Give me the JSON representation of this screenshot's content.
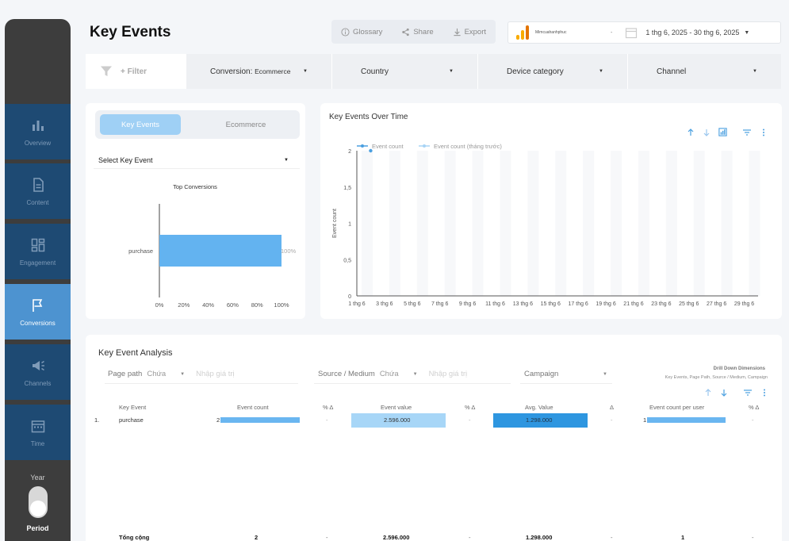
{
  "sidebar": {
    "items": [
      {
        "label": "Overview",
        "icon": "bar-chart-icon"
      },
      {
        "label": "Content",
        "icon": "document-icon"
      },
      {
        "label": "Engagement",
        "icon": "dashboard-icon"
      },
      {
        "label": "Conversions",
        "icon": "flag-icon",
        "active": true
      },
      {
        "label": "Channels",
        "icon": "megaphone-icon"
      },
      {
        "label": "Time",
        "icon": "calendar-icon"
      }
    ],
    "period": {
      "top_label": "Year",
      "label": "Period"
    }
  },
  "header": {
    "title": "Key Events",
    "buttons": {
      "glossary": "Glossary",
      "share": "Share",
      "export": "Export"
    },
    "account_name": "Mimcuahanhphuc",
    "account_caret": "-",
    "date_range": "1 thg 6, 2025 - 30 thg 6, 2025"
  },
  "filterbar": {
    "filter_label": "+ Filter",
    "conversion_label": "Conversion:",
    "conversion_value": "Ecommerce",
    "country": "Country",
    "device": "Device category",
    "channel": "Channel"
  },
  "left_panel": {
    "tabs": {
      "key_events": "Key Events",
      "ecommerce": "Ecommerce"
    },
    "select_placeholder": "Select Key Event"
  },
  "top_conversions_chart": {
    "chart_data": {
      "type": "bar",
      "orientation": "horizontal",
      "title": "Top Conversions",
      "categories": [
        "purchase"
      ],
      "values": [
        100
      ],
      "data_labels": [
        "100%"
      ],
      "xlim": [
        0,
        100
      ],
      "x_ticks": [
        "0%",
        "20%",
        "40%",
        "60%",
        "80%",
        "100%"
      ],
      "color": "#63b3f0"
    }
  },
  "over_time_chart": {
    "chart_data": {
      "type": "line",
      "title": "Key Events Over Time",
      "ylabel": "Event count",
      "ylim": [
        0,
        2
      ],
      "y_ticks": [
        "0",
        "0,5",
        "1",
        "1,5",
        "2"
      ],
      "x_ticks": [
        "1 thg 6",
        "3 thg 6",
        "5 thg 6",
        "7 thg 6",
        "9 thg 6",
        "11 thg 6",
        "13 thg 6",
        "15 thg 6",
        "17 thg 6",
        "19 thg 6",
        "21 thg 6",
        "23 thg 6",
        "25 thg 6",
        "27 thg 6",
        "29 thg 6"
      ],
      "x_tick_days": [
        1,
        3,
        5,
        7,
        9,
        11,
        13,
        15,
        17,
        19,
        21,
        23,
        25,
        27,
        29
      ],
      "x_range_days": [
        1,
        30
      ],
      "legend": [
        "Event count",
        "Event count (tháng trước)"
      ],
      "legend_position": "top-left",
      "series": [
        {
          "name": "Event count",
          "color": "#4a9fe0",
          "points": [
            {
              "day": 2,
              "value": 2
            }
          ]
        },
        {
          "name": "Event count (tháng trước)",
          "color": "#a8d4f5",
          "points": []
        }
      ]
    }
  },
  "analysis": {
    "title": "Key Event Analysis",
    "filters": [
      {
        "label": "Page path",
        "value": "Chứa",
        "placeholder": "Nhập giá trị"
      },
      {
        "label": "Source / Medium",
        "value": "Chứa",
        "placeholder": "Nhập giá trị"
      },
      {
        "label": "Campaign"
      }
    ],
    "drill_title": "Drill Down Dimensions",
    "drill_sub": "Key Events, Page Path, Source / Medium, Campaign",
    "columns": [
      "Key Event",
      "Event count",
      "% Δ",
      "Event value",
      "% Δ",
      "Avg. Value",
      "Δ",
      "Event count per user",
      "% Δ"
    ],
    "row": {
      "index": "1.",
      "key_event": "purchase",
      "event_count": "2",
      "ec_delta": "-",
      "event_value": "2.596.000",
      "ev_delta": "-",
      "avg_value": "1.298.000",
      "av_delta": "-",
      "per_user": "1",
      "pu_delta": "-"
    },
    "total": {
      "label": "Tổng cộng",
      "event_count": "2",
      "ec_delta": "-",
      "event_value": "2.596.000",
      "ev_delta": "-",
      "avg_value": "1.298.000",
      "av_delta": "-",
      "per_user": "1",
      "pu_delta": "-"
    }
  }
}
